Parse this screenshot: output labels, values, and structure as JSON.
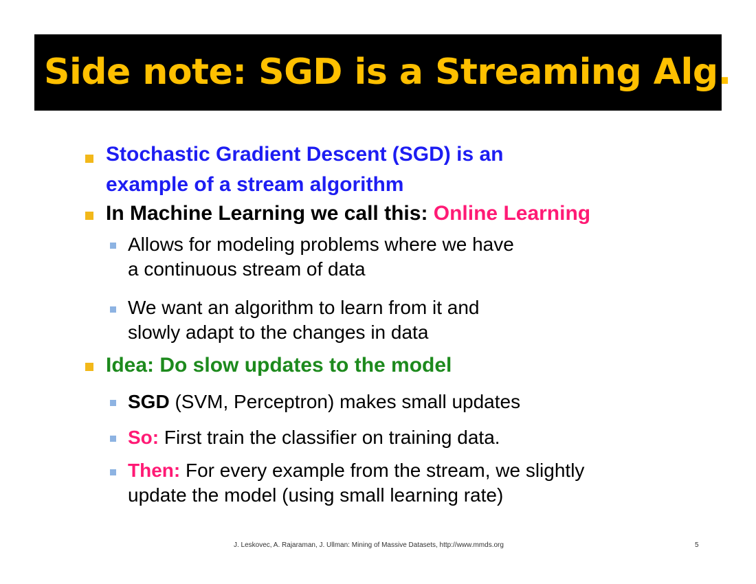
{
  "title": "Side note: SGD is a Streaming Alg.",
  "bullets": {
    "b1": {
      "line1": "Stochastic Gradient Descent (SGD) is an",
      "line2": "example of a stream algorithm"
    },
    "b2": {
      "text": "In Machine Learning we call this: ",
      "highlight": "Online Learning",
      "sub1": {
        "line1": "Allows for modeling problems where we have",
        "line2": "a continuous stream of data"
      },
      "sub2": {
        "line1": "We want an algorithm to learn from it and",
        "line2": "slowly adapt to the changes in data"
      }
    },
    "b3": {
      "text": "Idea: Do slow updates to the model",
      "sub1": {
        "bold": "SGD",
        "rest": " (SVM, Perceptron) makes small updates"
      },
      "sub2": {
        "label": "So:",
        "rest": " First train the classifier on training data."
      },
      "sub3": {
        "label": "Then:",
        "rest": " For every example from the stream, we slightly",
        "line2": "update the model (using small learning rate)"
      }
    }
  },
  "footer": {
    "citation": "J. Leskovec, A. Rajaraman, J. Ullman: Mining of Massive Datasets, http://www.mmds.org",
    "page_number": "5"
  },
  "colors": {
    "title_bg": "#000000",
    "title_text": "#ffc000",
    "bullet_l1": "#f2b81a",
    "bullet_l2": "#8db3e2",
    "blue": "#1d1df2",
    "pink": "#ff1a75",
    "green": "#1d8a1d"
  }
}
